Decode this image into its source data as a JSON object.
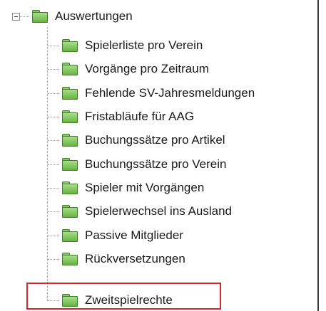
{
  "tree": {
    "root": {
      "label": "Auswertungen",
      "expanded": true,
      "icon": "folder-icon"
    },
    "children": [
      {
        "label": "Spielerliste pro Verein",
        "icon": "folder-icon"
      },
      {
        "label": "Vorgänge pro Zeitraum",
        "icon": "folder-icon"
      },
      {
        "label": "Fehlende SV-Jahresmeldungen",
        "icon": "folder-icon"
      },
      {
        "label": "Fristabläufe für AAG",
        "icon": "folder-icon"
      },
      {
        "label": "Buchungssätze pro Artikel",
        "icon": "folder-icon"
      },
      {
        "label": "Buchungssätze pro Verein",
        "icon": "folder-icon"
      },
      {
        "label": "Spieler mit Vorgängen",
        "icon": "folder-icon"
      },
      {
        "label": "Spielerwechsel ins Ausland",
        "icon": "folder-icon"
      },
      {
        "label": "Passive Mitglieder",
        "icon": "folder-icon"
      },
      {
        "label": "Rückversetzungen",
        "icon": "folder-icon"
      },
      {
        "label": "Zweitspielrechte",
        "icon": "folder-icon",
        "highlighted": true
      }
    ]
  },
  "colors": {
    "folder": "#7cc45a",
    "folder_border": "#3f7f25",
    "highlight_border": "#d9262a",
    "frame_border": "#3a3a3a"
  }
}
